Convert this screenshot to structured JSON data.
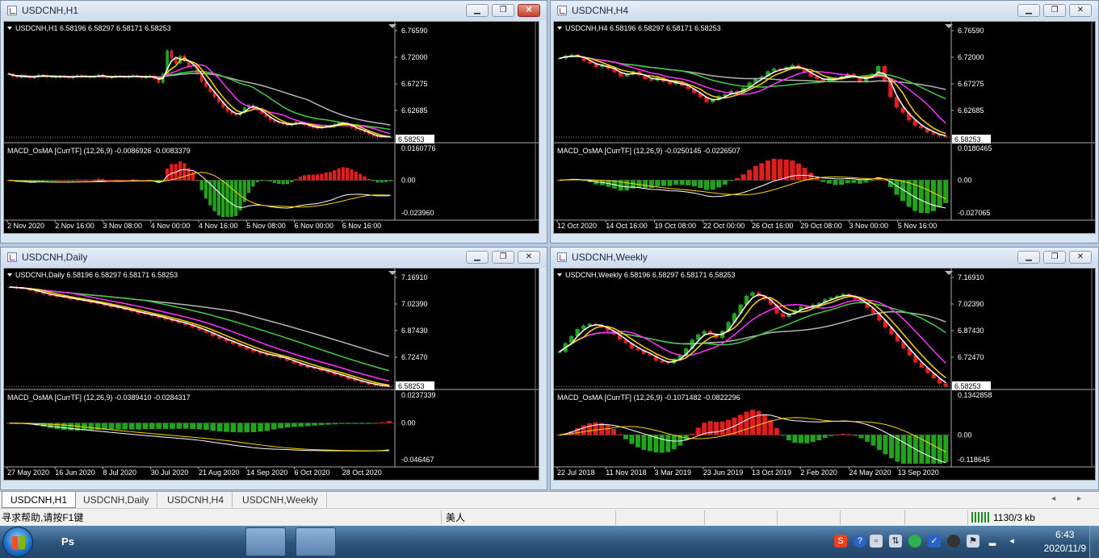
{
  "windows": [
    {
      "title": "USDCNH,H1",
      "header": "USDCNH,H1  6.58196 6.58297 6.58171 6.58253",
      "price_ticks": [
        "6.76590",
        "6.72000",
        "6.67275",
        "6.62685"
      ],
      "current_price": "6.58253",
      "macd_header": "MACD_OsMA [CurrTF] (12,26,9) -0.0086926 -0.0083379",
      "macd_ticks": [
        "0.0160776",
        "0.00",
        "-0.023960"
      ],
      "dates": [
        "2 Nov 2020",
        "2 Nov 16:00",
        "3 Nov 08:00",
        "4 Nov 00:00",
        "4 Nov 16:00",
        "5 Nov 08:00",
        "6 Nov 00:00",
        "6 Nov 16:00"
      ]
    },
    {
      "title": "USDCNH,H4",
      "header": "USDCNH,H4  6.58196 6.58297 6.58171 6.58253",
      "price_ticks": [
        "6.76590",
        "6.72000",
        "6.67275",
        "6.62685"
      ],
      "current_price": "6.58253",
      "macd_header": "MACD_OsMA [CurrTF] (12,26,9) -0.0250145 -0.0226507",
      "macd_ticks": [
        "0.0180465",
        "0.00",
        "-0.027065"
      ],
      "dates": [
        "12 Oct 2020",
        "14 Oct 16:00",
        "19 Oct 08:00",
        "22 Oct 00:00",
        "26 Oct 16:00",
        "29 Oct 08:00",
        "3 Nov 00:00",
        "5 Nov 16:00"
      ]
    },
    {
      "title": "USDCNH,Daily",
      "header": "USDCNH,Daily  6.58196 6.58297 6.58171 6.58253",
      "price_ticks": [
        "7.16910",
        "7.02390",
        "6.87430",
        "6.72470"
      ],
      "current_price": "6.58253",
      "macd_header": "MACD_OsMA [CurrTF] (12,26,9) -0.0389410 -0.0284317",
      "macd_ticks": [
        "0.0237339",
        "0.00",
        "-0.046467"
      ],
      "dates": [
        "27 May 2020",
        "16 Jun 2020",
        "8 Jul 2020",
        "30 Jul 2020",
        "21 Aug 2020",
        "14 Sep 2020",
        "6 Oct 2020",
        "28 Oct 2020"
      ]
    },
    {
      "title": "USDCNH,Weekly",
      "header": "USDCNH,Weekly  6.58196 6.58297 6.58171 6.58253",
      "price_ticks": [
        "7.16910",
        "7.02390",
        "6.87430",
        "6.72470"
      ],
      "current_price": "6.58253",
      "macd_header": "MACD_OsMA [CurrTF] (12,26,9) -0.1071482 -0.0822296",
      "macd_ticks": [
        "0.1342858",
        "0.00",
        "-0.118645"
      ],
      "dates": [
        "22 Jul 2018",
        "11 Nov 2018",
        "3 Mar 2019",
        "23 Jun 2019",
        "13 Oct 2019",
        "2 Feb 2020",
        "24 May 2020",
        "13 Sep 2020"
      ]
    }
  ],
  "window_buttons": {
    "minimize": "▁",
    "restore": "❐",
    "close": "✕"
  },
  "tabs": [
    "USDCNH,H1",
    "USDCNH,Daily",
    "USDCNH,H4",
    "USDCNH,Weekly"
  ],
  "tab_scroll": "◂ ▸",
  "status": {
    "help": "寻求帮助,请按F1键",
    "profile": "美人",
    "traffic": "1130/3 kb"
  },
  "taskbar": {
    "apps": [
      {
        "icon": "photoshop-icon",
        "label": "Ps",
        "color": "#1c3b6e"
      },
      {
        "icon": "browser-icon",
        "label": "",
        "color": "#f08a1c"
      },
      {
        "icon": "app-m-icon",
        "label": "",
        "color": "#1e78d2"
      },
      {
        "icon": "document-icon",
        "label": "",
        "color": "#d9e6f2"
      },
      {
        "icon": "metatrader-icon",
        "label": "",
        "color": "#e8eef6"
      },
      {
        "icon": "wechat-icon",
        "label": "",
        "color": "#2fb24a"
      }
    ],
    "time": "6:43",
    "date": "2020/11/9"
  },
  "colors": {
    "bull": "#23a21e",
    "bear": "#e01e1e",
    "ma_yellow": "#ffd400",
    "ma_white": "#ffffff",
    "ma_magenta": "#ff33ff",
    "ma_green": "#44cc44",
    "ma_gray": "#b4b4b4"
  },
  "chart_data": [
    {
      "type": "candlestick",
      "title": "USDCNH,H1",
      "bid": 6.58253,
      "ylim": [
        6.575,
        6.79
      ],
      "macd_ylim": [
        -0.02396,
        0.016078
      ],
      "closes": [
        6.705,
        6.7,
        6.698,
        6.702,
        6.699,
        6.697,
        6.7,
        6.703,
        6.701,
        6.699,
        6.7,
        6.698,
        6.701,
        6.699,
        6.697,
        6.7,
        6.702,
        6.699,
        6.7,
        6.698,
        6.701,
        6.703,
        6.7,
        6.697,
        6.699,
        6.701,
        6.7,
        6.698,
        6.7,
        6.702,
        6.699,
        6.697,
        6.7,
        6.701,
        6.695,
        6.688,
        6.705,
        6.75,
        6.735,
        6.725,
        6.74,
        6.73,
        6.72,
        6.722,
        6.705,
        6.69,
        6.68,
        6.67,
        6.66,
        6.65,
        6.64,
        6.632,
        6.628,
        6.625,
        6.63,
        6.64,
        6.645,
        6.64,
        6.635,
        6.628,
        6.622,
        6.615,
        6.612,
        6.61,
        6.608,
        6.605,
        6.608,
        6.612,
        6.61,
        6.606,
        6.603,
        6.601,
        6.6,
        6.602,
        6.605,
        6.603,
        6.608,
        6.611,
        6.61,
        6.606,
        6.601,
        6.598,
        6.596,
        6.592,
        6.588,
        6.585,
        6.583,
        6.584,
        6.583,
        6.583
      ]
    },
    {
      "type": "candlestick",
      "title": "USDCNH,H4",
      "bid": 6.58253,
      "ylim": [
        6.575,
        6.79
      ],
      "macd_ylim": [
        -0.027065,
        0.018047
      ],
      "closes": [
        6.735,
        6.74,
        6.742,
        6.738,
        6.73,
        6.725,
        6.718,
        6.722,
        6.715,
        6.708,
        6.7,
        6.705,
        6.71,
        6.702,
        6.695,
        6.692,
        6.698,
        6.69,
        6.685,
        6.69,
        6.682,
        6.676,
        6.668,
        6.66,
        6.65,
        6.655,
        6.662,
        6.665,
        6.672,
        6.668,
        6.678,
        6.688,
        6.695,
        6.7,
        6.71,
        6.715,
        6.712,
        6.718,
        6.722,
        6.715,
        6.708,
        6.7,
        6.695,
        6.69,
        6.698,
        6.695,
        6.7,
        6.705,
        6.698,
        6.69,
        6.7,
        6.705,
        6.72,
        6.69,
        6.66,
        6.64,
        6.63,
        6.615,
        6.605,
        6.6,
        6.592,
        6.588,
        6.585,
        6.583
      ]
    },
    {
      "type": "candlestick",
      "title": "USDCNH,Daily",
      "bid": 6.58253,
      "ylim": [
        6.575,
        7.21
      ],
      "macd_ylim": [
        -0.046467,
        0.023734
      ],
      "closes": [
        7.15,
        7.145,
        7.14,
        7.13,
        7.12,
        7.11,
        7.1,
        7.095,
        7.09,
        7.08,
        7.075,
        7.07,
        7.06,
        7.055,
        7.045,
        7.035,
        7.03,
        7.02,
        7.01,
        7.0,
        6.995,
        6.985,
        6.975,
        6.965,
        6.955,
        6.945,
        6.935,
        6.92,
        6.905,
        6.89,
        6.87,
        6.855,
        6.84,
        6.825,
        6.81,
        6.795,
        6.78,
        6.77,
        6.76,
        6.755,
        6.745,
        6.73,
        6.715,
        6.7,
        6.69,
        6.685,
        6.672,
        6.662,
        6.65,
        6.64,
        6.625,
        6.615,
        6.605,
        6.595,
        6.588,
        6.584,
        6.583
      ]
    },
    {
      "type": "candlestick",
      "title": "USDCNH,Weekly",
      "bid": 6.58253,
      "ylim": [
        6.575,
        7.21
      ],
      "macd_ylim": [
        -0.118645,
        0.134286
      ],
      "closes": [
        6.78,
        6.83,
        6.87,
        6.91,
        6.93,
        6.94,
        6.935,
        6.92,
        6.9,
        6.88,
        6.85,
        6.83,
        6.8,
        6.79,
        6.77,
        6.76,
        6.73,
        6.72,
        6.715,
        6.74,
        6.76,
        6.8,
        6.85,
        6.88,
        6.9,
        6.88,
        6.86,
        6.9,
        6.95,
        7.0,
        7.05,
        7.1,
        7.12,
        7.1,
        7.08,
        7.05,
        7.0,
        6.98,
        7.0,
        7.02,
        7.04,
        7.03,
        7.05,
        7.06,
        7.08,
        7.09,
        7.1,
        7.11,
        7.1,
        7.08,
        7.06,
        7.03,
        7.0,
        6.96,
        6.92,
        6.88,
        6.84,
        6.8,
        6.76,
        6.72,
        6.69,
        6.66,
        6.63,
        6.6,
        6.583
      ]
    }
  ]
}
